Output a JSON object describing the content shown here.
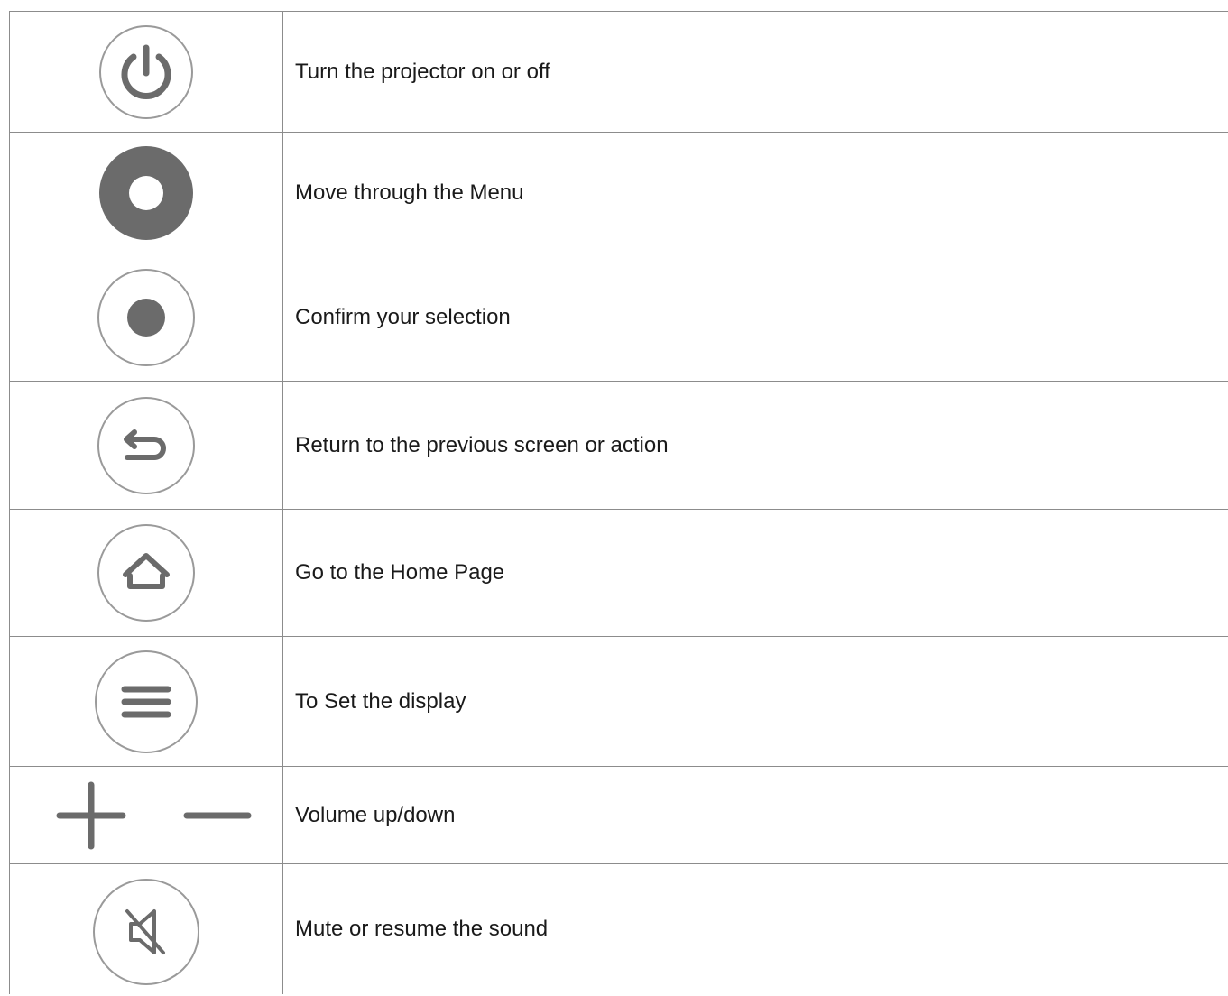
{
  "rows": [
    {
      "icon": "power-icon",
      "description": "Turn the projector on or off"
    },
    {
      "icon": "navigation-ring-icon",
      "description": "Move through the Menu"
    },
    {
      "icon": "ok-button-icon",
      "description": "Confirm your selection"
    },
    {
      "icon": "back-arrow-icon",
      "description": "Return to the previous screen or action"
    },
    {
      "icon": "home-icon",
      "description": "Go to the Home Page"
    },
    {
      "icon": "menu-lines-icon",
      "description": "To Set the display"
    },
    {
      "icon": "volume-plus-minus-icon",
      "description": "Volume up/down"
    },
    {
      "icon": "mute-speaker-icon",
      "description": "Mute or resume the sound"
    }
  ],
  "colors": {
    "icon_gray": "#6b6b6b",
    "ring_gray": "#9a9a9a",
    "border": "#8c8c8c",
    "text": "#1a1a1a"
  }
}
